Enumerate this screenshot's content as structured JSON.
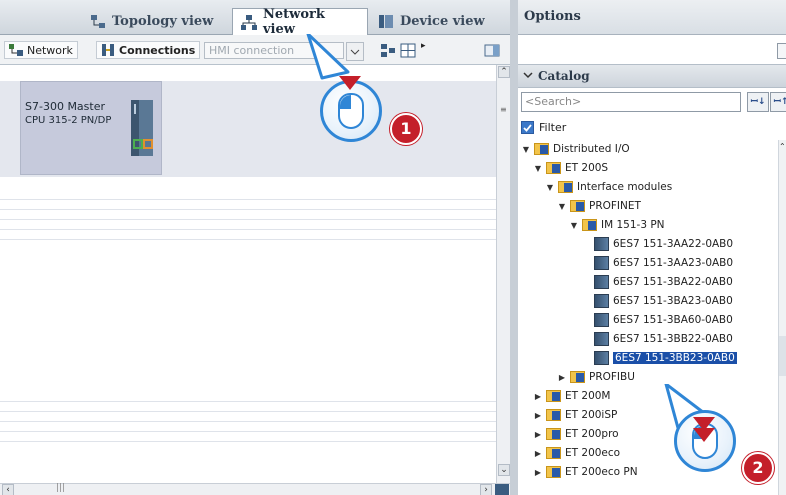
{
  "tabs": [
    {
      "label": "Topology view",
      "icon": "topology-icon"
    },
    {
      "label": "Network view",
      "icon": "network-icon"
    },
    {
      "label": "Device view",
      "icon": "device-icon"
    }
  ],
  "toolbar": {
    "network_label": "Network",
    "connections_label": "Connections",
    "connection_type_value": "HMI connection"
  },
  "device": {
    "name": "S7-300 Master",
    "cpu": "CPU 315-2 PN/DP"
  },
  "options": {
    "title": "Options",
    "catalog_title": "Catalog",
    "search_placeholder": "<Search>",
    "filter_label": "Filter",
    "filter_checked": true
  },
  "tree": [
    {
      "label": "Distributed I/O",
      "level": 0,
      "expanded": true,
      "type": "folder"
    },
    {
      "label": "ET 200S",
      "level": 1,
      "expanded": true,
      "type": "folder"
    },
    {
      "label": "Interface modules",
      "level": 2,
      "expanded": true,
      "type": "folder"
    },
    {
      "label": "PROFINET",
      "level": 3,
      "expanded": true,
      "type": "folder"
    },
    {
      "label": "IM 151-3 PN",
      "level": 4,
      "expanded": true,
      "type": "folder"
    },
    {
      "label": "6ES7 151-3AA22-0AB0",
      "level": 5,
      "type": "module"
    },
    {
      "label": "6ES7 151-3AA23-0AB0",
      "level": 5,
      "type": "module"
    },
    {
      "label": "6ES7 151-3BA22-0AB0",
      "level": 5,
      "type": "module"
    },
    {
      "label": "6ES7 151-3BA23-0AB0",
      "level": 5,
      "type": "module"
    },
    {
      "label": "6ES7 151-3BA60-0AB0",
      "level": 5,
      "type": "module"
    },
    {
      "label": "6ES7 151-3BB22-0AB0",
      "level": 5,
      "type": "module"
    },
    {
      "label": "6ES7 151-3BB23-0AB0",
      "level": 5,
      "type": "module",
      "selected": true
    },
    {
      "label": "PROFIBU",
      "level": 3,
      "expanded": false,
      "type": "folder"
    },
    {
      "label": "ET 200M",
      "level": 1,
      "expanded": false,
      "type": "folder"
    },
    {
      "label": "ET 200iSP",
      "level": 1,
      "expanded": false,
      "type": "folder"
    },
    {
      "label": "ET 200pro",
      "level": 1,
      "expanded": false,
      "type": "folder"
    },
    {
      "label": "ET 200eco",
      "level": 1,
      "expanded": false,
      "type": "folder"
    },
    {
      "label": "ET 200eco PN",
      "level": 1,
      "expanded": false,
      "type": "folder"
    }
  ],
  "callouts": [
    {
      "number": "1"
    },
    {
      "number": "2"
    }
  ],
  "colors": {
    "accent": "#2f86d6",
    "badge": "#c41f2a",
    "selection": "#1a4fa8"
  }
}
